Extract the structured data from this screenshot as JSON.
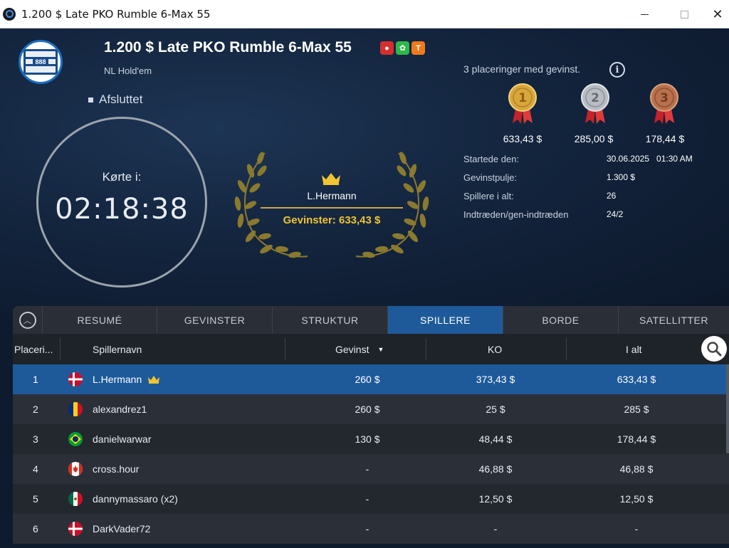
{
  "window": {
    "title": "1.200 $ Late PKO Rumble 6-Max 55"
  },
  "tournament": {
    "name": "1.200 $ Late PKO Rumble 6-Max 55",
    "game": "NL Hold'em",
    "status": "Afsluttet",
    "logo_text": "888",
    "tags": [
      "bounty",
      "mystery",
      "T"
    ],
    "ran_label": "Kørte i:",
    "ran_time": "02:18:38"
  },
  "winner": {
    "name": "L.Hermann",
    "prize": "Gevinster: 633,43 $"
  },
  "places": {
    "label": "3 placeringer med gevinst.",
    "info_icon": "i"
  },
  "medals": [
    {
      "rank": "1",
      "amount": "633,43 $",
      "color": "#d9a63b"
    },
    {
      "rank": "2",
      "amount": "285,00 $",
      "color": "#b9bdc3"
    },
    {
      "rank": "3",
      "amount": "178,44 $",
      "color": "#b9714d"
    }
  ],
  "stats": [
    {
      "key": "Startede den:",
      "value": "30.06.2025   01:30 AM"
    },
    {
      "key": "Gevinstpulje:",
      "value": "1.300 $"
    },
    {
      "key": "Spillere i alt:",
      "value": "26"
    },
    {
      "key": "Indtræden/gen-indtræden",
      "value": "24/2"
    }
  ],
  "tabs": [
    "RESUMÉ",
    "GEVINSTER",
    "STRUKTUR",
    "SPILLERE",
    "BORDE",
    "SATELLITTER"
  ],
  "active_tab": "SPILLERE",
  "columns": {
    "place": "Placeri...",
    "name": "Spillernavn",
    "prize": "Gevinst",
    "ko": "KO",
    "total": "I alt"
  },
  "rows": [
    {
      "place": "1",
      "flag": "dk",
      "name": "L.Hermann",
      "crown": true,
      "prize": "260 $",
      "ko": "373,43 $",
      "total": "633,43 $"
    },
    {
      "place": "2",
      "flag": "ro",
      "name": "alexandrez1",
      "crown": false,
      "prize": "260 $",
      "ko": "25 $",
      "total": "285 $"
    },
    {
      "place": "3",
      "flag": "br",
      "name": "danielwarwar",
      "crown": false,
      "prize": "130 $",
      "ko": "48,44 $",
      "total": "178,44 $"
    },
    {
      "place": "4",
      "flag": "ca",
      "name": "cross.hour",
      "crown": false,
      "prize": "-",
      "ko": "46,88 $",
      "total": "46,88 $"
    },
    {
      "place": "5",
      "flag": "mx",
      "name": "dannymassaro (x2)",
      "crown": false,
      "prize": "-",
      "ko": "12,50 $",
      "total": "12,50 $"
    },
    {
      "place": "6",
      "flag": "dk",
      "name": "DarkVader72",
      "crown": false,
      "prize": "-",
      "ko": "-",
      "total": "-"
    }
  ],
  "colors": {
    "accent": "#1e5a9a",
    "gold": "#f0c431"
  }
}
